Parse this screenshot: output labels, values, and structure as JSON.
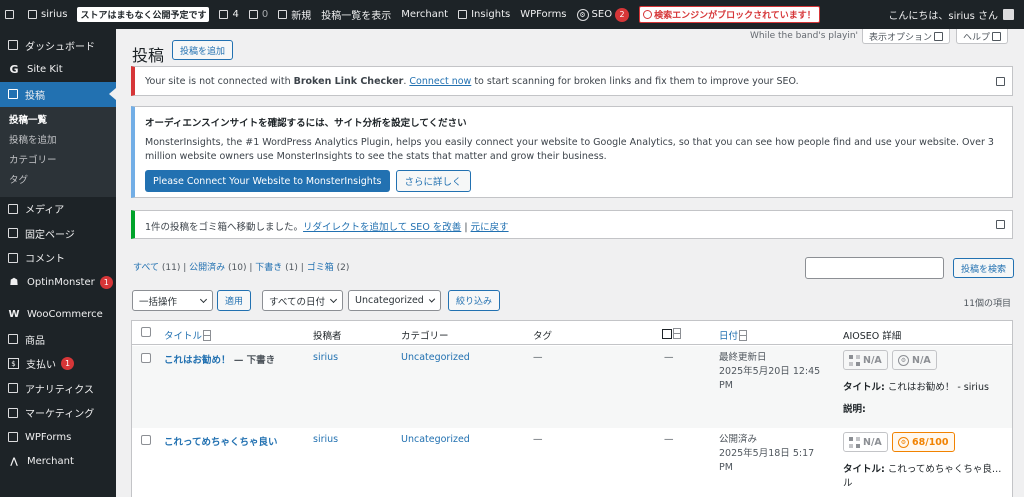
{
  "admin_bar": {
    "site_name": "sirius",
    "store_notice": "ストアはまもなく公開予定です",
    "updates_count": "4",
    "comments_count": "0",
    "new_label": "新規",
    "view_posts": "投稿一覧を表示",
    "merchant": "Merchant",
    "insights": "Insights",
    "wpforms": "WPForms",
    "seo": "SEO",
    "seo_count": "2",
    "search_blocked": "検索エンジンがブロックされています！",
    "greeting": "こんにちは、sirius さん"
  },
  "sidebar": {
    "items": [
      {
        "label": "ダッシュボード",
        "icon": "dashboard-icon"
      },
      {
        "label": "Site Kit",
        "icon": "sitekit-icon"
      },
      {
        "label": "投稿",
        "icon": "posts-icon"
      },
      {
        "label": "メディア",
        "icon": "media-icon"
      },
      {
        "label": "固定ページ",
        "icon": "pages-icon"
      },
      {
        "label": "コメント",
        "icon": "comments-icon"
      },
      {
        "label": "OptinMonster",
        "icon": "optinmonster-icon",
        "badge": "1"
      },
      {
        "label": "WooCommerce",
        "icon": "woocommerce-icon"
      },
      {
        "label": "商品",
        "icon": "products-icon"
      },
      {
        "label": "支払い",
        "icon": "payments-icon",
        "badge": "1"
      },
      {
        "label": "アナリティクス",
        "icon": "analytics-icon"
      },
      {
        "label": "マーケティング",
        "icon": "marketing-icon"
      },
      {
        "label": "WPForms",
        "icon": "wpforms-icon"
      },
      {
        "label": "Merchant",
        "icon": "merchant-icon"
      }
    ],
    "submenu": [
      "投稿一覧",
      "投稿を追加",
      "カテゴリー",
      "タグ"
    ]
  },
  "header": {
    "title": "投稿",
    "add_new": "投稿を追加",
    "quote": "While the band's playin'",
    "screen_options": "表示オプション",
    "help": "ヘルプ"
  },
  "notices": {
    "blc": {
      "prefix": "Your site is not connected with ",
      "bold": "Broken Link Checker",
      "mid": ". ",
      "link": "Connect now",
      "suffix": " to start scanning for broken links and fix them to improve your SEO."
    },
    "monsterinsights": {
      "heading": "オーディエンスインサイトを確認するには、サイト分析を設定してください",
      "body": "MonsterInsights, the #1 WordPress Analytics Plugin, helps you easily connect your website to Google Analytics, so that you can see how people find and use your website. Over 3 million website owners use MonsterInsights to see the stats that matter and grow their business.",
      "primary_btn": "Please Connect Your Website to MonsterInsights",
      "secondary_btn": "さらに詳しく"
    },
    "trash": {
      "text": "1件の投稿をゴミ箱へ移動しました。",
      "redirect_link": "リダイレクトを追加して SEO を改善",
      "sep": " | ",
      "undo_link": "元に戻す"
    }
  },
  "filters": {
    "all": "すべて",
    "all_count": "(11)",
    "published": "公開済み",
    "published_count": "(10)",
    "draft": "下書き",
    "draft_count": "(1)",
    "trash": "ゴミ箱",
    "trash_count": "(2)",
    "search_value": "",
    "search_btn": "投稿を検索",
    "bulk_action": "一括操作",
    "apply": "適用",
    "all_dates": "すべての日付",
    "category": "Uncategorized",
    "filter": "絞り込み",
    "item_count": "11個の項目"
  },
  "table": {
    "headers": {
      "title": "タイトル",
      "author": "投稿者",
      "category": "カテゴリー",
      "tags": "タグ",
      "date": "日付",
      "aioseo": "AIOSEO 詳細"
    },
    "rows": [
      {
        "title": "これはお勧め！",
        "state": " — 下書き",
        "author": "sirius",
        "category": "Uncategorized",
        "tags": "—",
        "comments": "—",
        "date_status": "最終更新日",
        "date_value": "2025年5月20日 12:45 PM",
        "score1": "N/A",
        "score2": "N/A",
        "seo_title_label": "タイトル:",
        "seo_title": "これはお勧め！ - sirius",
        "seo_desc_label": "説明:"
      },
      {
        "title": "これってめちゃくちゃ良い",
        "state": "",
        "author": "sirius",
        "category": "Uncategorized",
        "tags": "—",
        "comments": "—",
        "date_status": "公開済み",
        "date_value": "2025年5月18日 5:17 PM",
        "score1": "N/A",
        "score2": "68/100",
        "seo_title_label": "タイトル:",
        "seo_title": "これってめちゃくちゃ良…",
        "seo_title_cont": "ル"
      }
    ]
  },
  "colors": {
    "admin_dark": "#1d2327",
    "accent_blue": "#2271b1",
    "notice_red": "#d63638",
    "notice_green": "#00a32a",
    "seo_orange": "#f18200"
  }
}
